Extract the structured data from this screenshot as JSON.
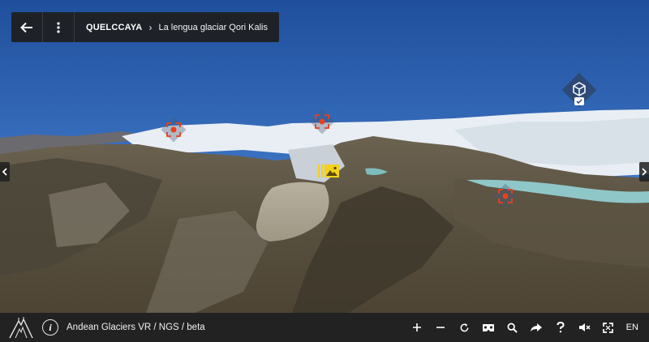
{
  "header": {
    "back_icon": "arrow-left-icon",
    "menu_icon": "more-vertical-icon",
    "breadcrumb_root": "QUELCCAYA",
    "breadcrumb_separator": "›",
    "breadcrumb_current": "La lengua glaciar Qori Kalis"
  },
  "scene": {
    "description_icon_names": [
      "target-hotspot-icon",
      "cube-3d-icon",
      "photo-gallery-icon"
    ],
    "hotspot_color": "#e8401c",
    "media_hotspot_color": "#f2d21b"
  },
  "footer": {
    "logo_icon": "mountain-logo-icon",
    "info_label": "i",
    "title": "Andean Glaciers VR / NGS / beta",
    "tools": [
      {
        "name": "zoom-in",
        "icon": "plus-icon",
        "glyph": "+"
      },
      {
        "name": "zoom-out",
        "icon": "minus-icon",
        "glyph": "−"
      },
      {
        "name": "rotate",
        "icon": "rotate-icon"
      },
      {
        "name": "vr",
        "icon": "vr-headset-icon"
      },
      {
        "name": "search",
        "icon": "search-icon"
      },
      {
        "name": "share",
        "icon": "share-icon"
      },
      {
        "name": "help",
        "icon": "help-icon",
        "glyph": "?"
      },
      {
        "name": "mute",
        "icon": "speaker-mute-icon"
      },
      {
        "name": "fullscreen",
        "icon": "fullscreen-icon"
      }
    ],
    "language": "EN"
  }
}
